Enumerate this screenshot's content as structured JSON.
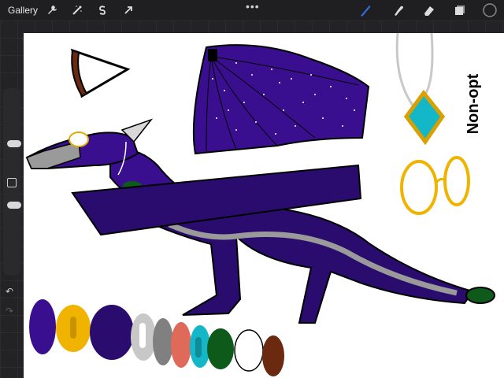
{
  "app": {
    "gallery_label": "Gallery"
  },
  "toolbar_left": {
    "icons": [
      "wrench-icon",
      "magic-wand-icon",
      "selection-s-icon",
      "transform-arrow-icon"
    ]
  },
  "toolbar_right": {
    "icons": [
      "brush-icon",
      "smudge-icon",
      "eraser-icon",
      "layers-icon",
      "color-swatch-icon"
    ],
    "active_tool": "brush",
    "accent_color": "#2f6fe0",
    "current_color": "#1f1f21"
  },
  "sidebar": {
    "undo_symbol": "↶",
    "redo_symbol": "↷"
  },
  "artwork": {
    "annotation": "Non-opt",
    "palette": [
      "#3a0f8f",
      "#f0b400",
      "#2a0b6e",
      "#c8c8c8",
      "#808080",
      "#e06a5a",
      "#13b7c8",
      "#0d5a1a",
      "#ffffff",
      "#6b2a10"
    ]
  }
}
